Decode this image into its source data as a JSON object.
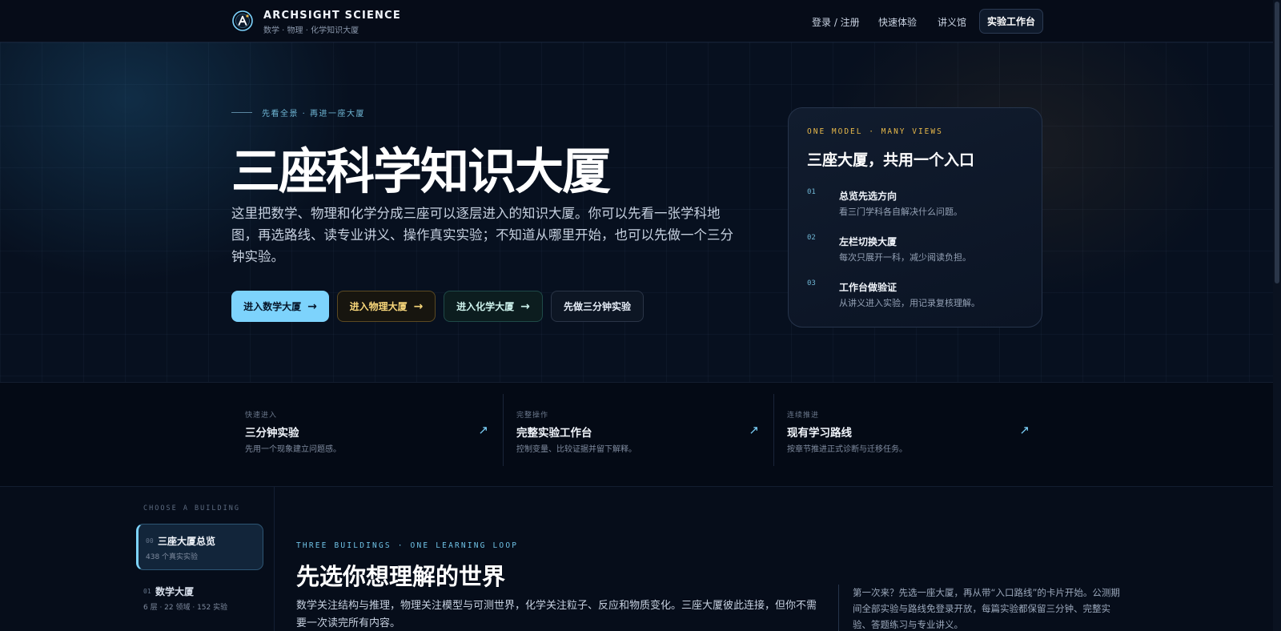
{
  "header": {
    "brand_name": "ARCHSIGHT SCIENCE",
    "brand_tagline": "数学 · 物理 · 化学知识大厦",
    "nav": [
      "登录 / 注册",
      "快速体验",
      "讲义馆"
    ],
    "primary_nav": "实验工作台"
  },
  "hero": {
    "eyebrow": "先看全景 · 再进一座大厦",
    "title": "三座科学知识大厦",
    "description": "这里把数学、物理和化学分成三座可以逐层进入的知识大厦。你可以先看一张学科地图，再选路线、读专业讲义、操作真实实验；不知道从哪里开始，也可以先做一个三分钟实验。",
    "ctas": [
      {
        "label": "进入数学大厦",
        "arrow": "→"
      },
      {
        "label": "进入物理大厦",
        "arrow": "→"
      },
      {
        "label": "进入化学大厦",
        "arrow": "→"
      },
      {
        "label": "先做三分钟实验"
      }
    ]
  },
  "card": {
    "eyebrow": "ONE MODEL · MANY VIEWS",
    "title": "三座大厦，共用一个入口",
    "steps": [
      {
        "num": "01",
        "title": "总览先选方向",
        "desc": "看三门学科各自解决什么问题。"
      },
      {
        "num": "02",
        "title": "左栏切换大厦",
        "desc": "每次只展开一科，减少阅读负担。"
      },
      {
        "num": "03",
        "title": "工作台做验证",
        "desc": "从讲义进入实验，用记录复核理解。"
      }
    ]
  },
  "quick_links": [
    {
      "kicker": "快速进入",
      "title": "三分钟实验",
      "desc": "先用一个现象建立问题感。",
      "arrow": "↗"
    },
    {
      "kicker": "完整操作",
      "title": "完整实验工作台",
      "desc": "控制变量、比较证据并留下解释。",
      "arrow": "↗"
    },
    {
      "kicker": "连续推进",
      "title": "现有学习路线",
      "desc": "按章节推进正式诊断与迁移任务。",
      "arrow": "↗"
    }
  ],
  "sidebar": {
    "kicker": "CHOOSE A BUILDING",
    "items": [
      {
        "num": "00",
        "title": "三座大厦总览",
        "meta": "438 个真实实验"
      },
      {
        "num": "01",
        "title": "数学大厦",
        "meta": "6 层 · 22 领域 · 152 实验"
      }
    ]
  },
  "section": {
    "kicker": "THREE BUILDINGS · ONE LEARNING LOOP",
    "title": "先选你想理解的世界",
    "description": "数学关注结构与推理，物理关注模型与可测世界，化学关注粒子、反应和物质变化。三座大厦彼此连接，但你不需要一次读完所有内容。",
    "note": "第一次来？先选一座大厦，再从带“入口路线”的卡片开始。公测期间全部实验与路线免登录开放，每篇实验都保留三分钟、完整实验、答题练习与专业讲义。"
  },
  "colors": {
    "accent_blue": "#7dd3fc",
    "accent_gold": "#e7b84a",
    "background": "#060d1a"
  },
  "icons": {
    "logo": "atom-a-logo-icon",
    "arrow": "arrow-right-icon",
    "external": "arrow-up-right-icon"
  }
}
